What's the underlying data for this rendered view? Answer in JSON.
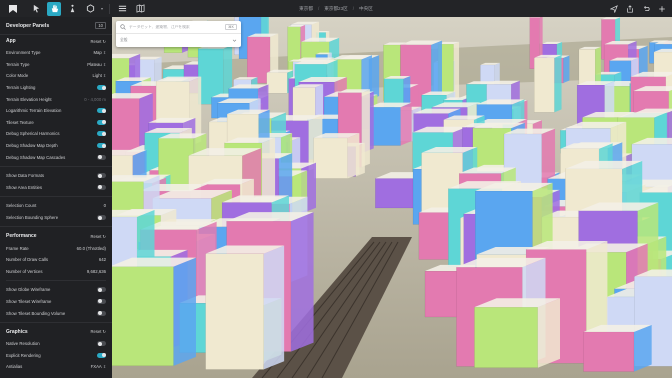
{
  "topbar": {
    "breadcrumb": [
      "東京都",
      "東京都23区",
      "中央区"
    ],
    "tools": [
      "select-tool",
      "hand-tool",
      "pedestrian-tool",
      "location-tool"
    ],
    "right_icons": [
      "send-icon",
      "share-icon",
      "undo-icon",
      "add-icon"
    ]
  },
  "panel": {
    "title": "Developer Panels",
    "count": "10"
  },
  "app": {
    "title": "App",
    "reset": "Reset",
    "rows": [
      {
        "label": "Environment Type",
        "value": "Map",
        "kind": "select"
      },
      {
        "label": "Terrain Type",
        "value": "Plateau",
        "kind": "select"
      },
      {
        "label": "Color Mode",
        "value": "Light",
        "kind": "select"
      },
      {
        "label": "Terrain Lighting",
        "value": "",
        "kind": "toggle",
        "on": true
      },
      {
        "label": "Terrain Elevation Height",
        "value": "0 - 4,000 m",
        "kind": "dim"
      },
      {
        "label": "Logarithmic Terrain Elevation",
        "value": "",
        "kind": "toggle",
        "on": true
      },
      {
        "label": "Tileset Texture",
        "value": "",
        "kind": "toggle",
        "on": true
      },
      {
        "label": "Debug Spherical Harmonics",
        "value": "",
        "kind": "toggle",
        "on": true
      },
      {
        "label": "Debug Shadow Map Depth",
        "value": "",
        "kind": "toggle",
        "on": true
      },
      {
        "label": "Debug Shadow Map Cascades",
        "value": "",
        "kind": "toggle",
        "on": false
      }
    ]
  },
  "data": {
    "rows": [
      {
        "label": "Show Data Formats",
        "on": false
      },
      {
        "label": "Show Area Entities",
        "on": false
      }
    ]
  },
  "selection": {
    "count_label": "Selection Count",
    "count_value": "0",
    "sphere_label": "Selection Bounding Sphere",
    "sphere_on": false
  },
  "performance": {
    "title": "Performance",
    "reset": "Reset",
    "rows": [
      {
        "label": "Frame Rate",
        "value": "60.0 (Throttled)"
      },
      {
        "label": "Number of Draw Calls",
        "value": "642"
      },
      {
        "label": "Number of Vertices",
        "value": "9,682,636"
      }
    ],
    "toggles": [
      {
        "label": "Show Globe Wireframe",
        "on": false
      },
      {
        "label": "Show Tileset Wireframe",
        "on": false
      },
      {
        "label": "Show Tileset Bounding Volume",
        "on": false
      }
    ]
  },
  "graphics": {
    "title": "Graphics",
    "reset": "Reset",
    "rows": [
      {
        "label": "Native Resolution",
        "value": "",
        "kind": "toggle",
        "on": false
      },
      {
        "label": "Explicit Rendering",
        "value": "",
        "kind": "toggle",
        "on": true
      },
      {
        "label": "Antialias",
        "value": "FXAA",
        "kind": "select"
      }
    ]
  },
  "search": {
    "placeholder": "データセット、建築物、江戸を検索",
    "kbd": "⌘K",
    "filter_label": "全般"
  },
  "colors": {
    "accent": "#2aa9c4",
    "sidebar_bg": "#202124",
    "topbar_bg": "#232427",
    "building_pink": "#e37ab0",
    "building_blue": "#5aa6f0",
    "building_purple": "#a06ee0",
    "building_green": "#b9e67a",
    "building_cyan": "#5ed6d6"
  }
}
